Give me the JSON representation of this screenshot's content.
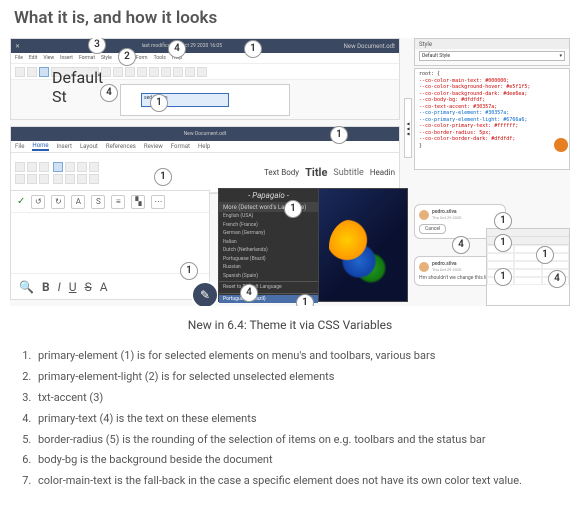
{
  "heading": "What it is, and how it looks",
  "caption": "New in 6.4: Theme it via CSS Variables",
  "app_a": {
    "titlebar_left": "✕",
    "titlebar_center": "last modification: Oct 29 2020 16:05",
    "titlebar_right": "New Document.odt",
    "menus": [
      "File",
      "Edit",
      "View",
      "Insert",
      "Format",
      "Style",
      "Table",
      "Form",
      "Tools",
      "Help"
    ],
    "font_name": "Default St",
    "selbox_text": "sed Lorem"
  },
  "app_b": {
    "titlebar": "New Document.odt",
    "tabs": [
      "File",
      "Home",
      "Insert",
      "Layout",
      "References",
      "Review",
      "Format",
      "Help"
    ],
    "styles": {
      "textbody": "Text Body",
      "title": "Title",
      "subtitle": "Subtitle",
      "heading": "Headin"
    }
  },
  "app_c": {
    "check": "✓",
    "format_b": "B",
    "format_i": "I",
    "format_u": "U",
    "format_s": "S",
    "format_a": "A",
    "fab": "✎"
  },
  "lang": {
    "title": "- Papagaio -",
    "group1": "More (Detect word's Language)",
    "items1": [
      "English (USA)",
      "French (France)",
      "German (Germany)",
      "Italian",
      "Dutch (Netherlands)",
      "Portuguese (Brazil)",
      "Russian",
      "Spanish (Spain)"
    ],
    "reset": "Reset to Default Language",
    "group2_item": "Portuguese (Brazil)"
  },
  "style_panel": {
    "title": "Style",
    "value": "Default Style"
  },
  "code": {
    "l0": "root: {",
    "l1": "--co-color-main-text: #000000;",
    "l2": "--co-color-background-hover: #e5f1f5;",
    "l3": "--co-color-background-dark: #dee6ea;",
    "l4": "--co-body-bg: #dfdfdf;",
    "l5": "--co-text-accent: #30357a;",
    "l6": "--co-primary-element: #30357a;",
    "l7": "--co-primary-element-light: #6766a6;",
    "l8": "--co-color-primary-text: #ffffff;",
    "l9": "--co-border-radius: 5px;",
    "l10": "--co-color-border-dark: #dfdfdf;",
    "l11": "}"
  },
  "comment1": {
    "name": "pedro.silva",
    "date": "Thu Oct 29 2020",
    "btn": "Cancel"
  },
  "comment2": {
    "name": "pedro.silva",
    "date": "Thu Oct 29 2020",
    "text": "Hm shouldn't we change this line?"
  },
  "legend": [
    "primary-element (1) is for selected elements on menu's and toolbars, various bars",
    "primary-element-light (2) is for selected unselected elements",
    "txt-accent (3)",
    "primary-text (4) is the text on these elements",
    "border-radius (5) is the rounding of the selection of  items on e.g. toolbars and the status bar",
    "body-bg is the background beside the document",
    "color-main-text is the fall-back in the case a specific element does not have its own color text value."
  ],
  "callouts": {
    "a3": "3",
    "a2": "2",
    "a4t": "4",
    "a1t": "1",
    "a4d": "4",
    "a1d": "1",
    "b1t": "1",
    "b1r": "1",
    "c1": "1",
    "c4": "4",
    "l1": "1",
    "l4": "4",
    "l1b": "1",
    "cm1a": "1",
    "cm4": "4",
    "cm1b": "1",
    "cm2": "1",
    "sh1": "1",
    "sh4": "4"
  }
}
